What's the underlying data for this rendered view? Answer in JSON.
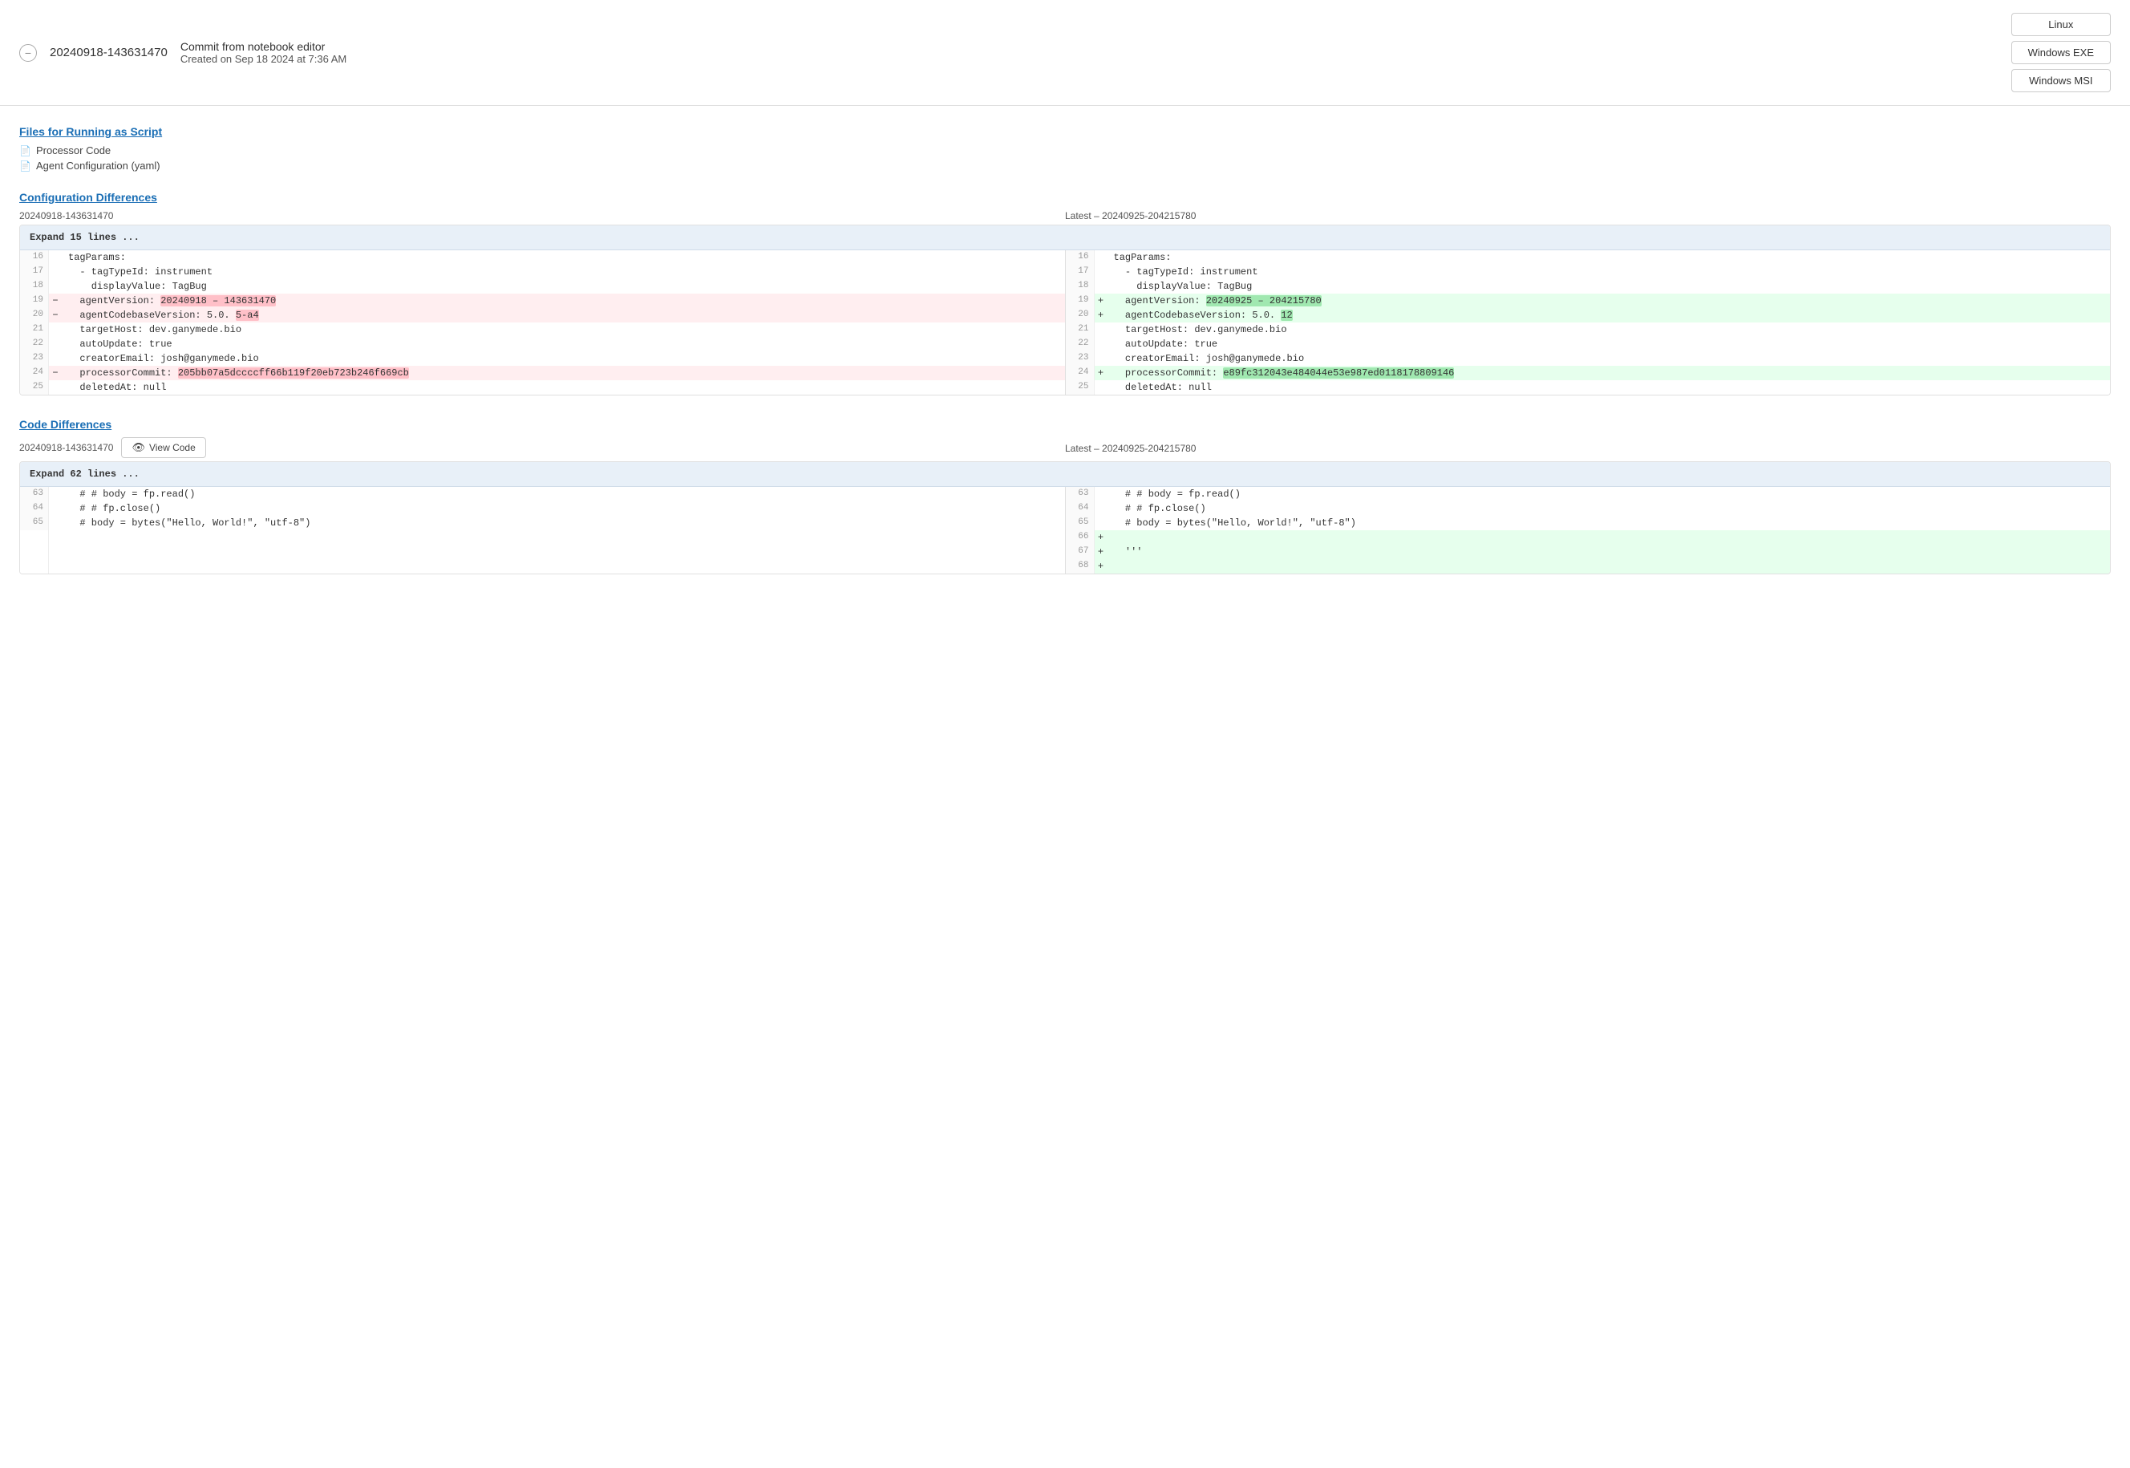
{
  "header": {
    "commit_id": "20240918-143631470",
    "collapse_icon": "−",
    "commit_title": "Commit from notebook editor",
    "commit_subtitle": "Created on Sep 18 2024 at 7:36 AM",
    "platforms": [
      "Linux",
      "Windows EXE",
      "Windows MSI"
    ]
  },
  "files_section": {
    "title": "Files for Running as Script",
    "files": [
      {
        "icon": "📄",
        "name": "Processor Code"
      },
      {
        "icon": "📄",
        "name": "Agent Configuration (yaml)"
      }
    ]
  },
  "config_diff": {
    "title": "Configuration Differences",
    "left_label": "20240918-143631470",
    "right_label": "Latest – 20240925-204215780",
    "expand_label": "Expand 15 lines ...",
    "rows": [
      {
        "type": "neutral",
        "left_num": "16",
        "left_content": "tagParams:",
        "right_num": "16",
        "right_content": "tagParams:"
      },
      {
        "type": "neutral",
        "left_num": "17",
        "left_content": "  - tagTypeId: instrument",
        "right_num": "17",
        "right_content": "  - tagTypeId: instrument"
      },
      {
        "type": "neutral",
        "left_num": "18",
        "left_content": "    displayValue: TagBug",
        "right_num": "18",
        "right_content": "    displayValue: TagBug"
      },
      {
        "type": "changed",
        "left_num": "19",
        "left_marker": "-",
        "left_content": "  agentVersion: ",
        "left_hl": "20240918 – 143631470",
        "right_num": "19",
        "right_marker": "+",
        "right_content": "  agentVersion: ",
        "right_hl": "20240925 – 204215780"
      },
      {
        "type": "changed",
        "left_num": "20",
        "left_marker": "-",
        "left_content": "  agentCodebaseVersion: 5.0. ",
        "left_hl": "5-a4",
        "right_num": "20",
        "right_marker": "+",
        "right_content": "  agentCodebaseVersion: 5.0. ",
        "right_hl": "12"
      },
      {
        "type": "neutral",
        "left_num": "21",
        "left_content": "  targetHost: dev.ganymede.bio",
        "right_num": "21",
        "right_content": "  targetHost: dev.ganymede.bio"
      },
      {
        "type": "neutral",
        "left_num": "22",
        "left_content": "  autoUpdate: true",
        "right_num": "22",
        "right_content": "  autoUpdate: true"
      },
      {
        "type": "neutral",
        "left_num": "23",
        "left_content": "  creatorEmail: josh@ganymede.bio",
        "right_num": "23",
        "right_content": "  creatorEmail: josh@ganymede.bio"
      },
      {
        "type": "changed",
        "left_num": "24",
        "left_marker": "-",
        "left_content": "  processorCommit: ",
        "left_hl": "205bb07a5dccccff66b119f20eb723b246f669cb",
        "right_num": "24",
        "right_marker": "+",
        "right_content": "  processorCommit: ",
        "right_hl": "e89fc312043e484044e53e987ed0118178809146"
      },
      {
        "type": "neutral",
        "left_num": "25",
        "left_content": "  deletedAt: null",
        "right_num": "25",
        "right_content": "  deletedAt: null"
      }
    ]
  },
  "code_diff": {
    "title": "Code Differences",
    "left_label": "20240918-143631470",
    "right_label": "Latest – 20240925-204215780",
    "view_code_label": "View Code",
    "expand_label": "Expand 62 lines ...",
    "rows": [
      {
        "type": "neutral",
        "left_num": "63",
        "left_content": "  # # body = fp.read()",
        "right_num": "63",
        "right_content": "  # # body = fp.read()"
      },
      {
        "type": "neutral",
        "left_num": "64",
        "left_content": "  # # fp.close()",
        "right_num": "64",
        "right_content": "  # # fp.close()"
      },
      {
        "type": "neutral",
        "left_num": "65",
        "left_content": "  # body = bytes(\"Hello, World!\", \"utf-8\")",
        "right_num": "65",
        "right_content": "  # body = bytes(\"Hello, World!\", \"utf-8\")"
      },
      {
        "type": "right_only",
        "right_num": "66",
        "right_marker": "+",
        "right_content": ""
      },
      {
        "type": "right_only",
        "right_num": "67",
        "right_marker": "+",
        "right_content": "  '''"
      },
      {
        "type": "right_only",
        "right_num": "68",
        "right_marker": "+",
        "right_content": ""
      }
    ]
  }
}
